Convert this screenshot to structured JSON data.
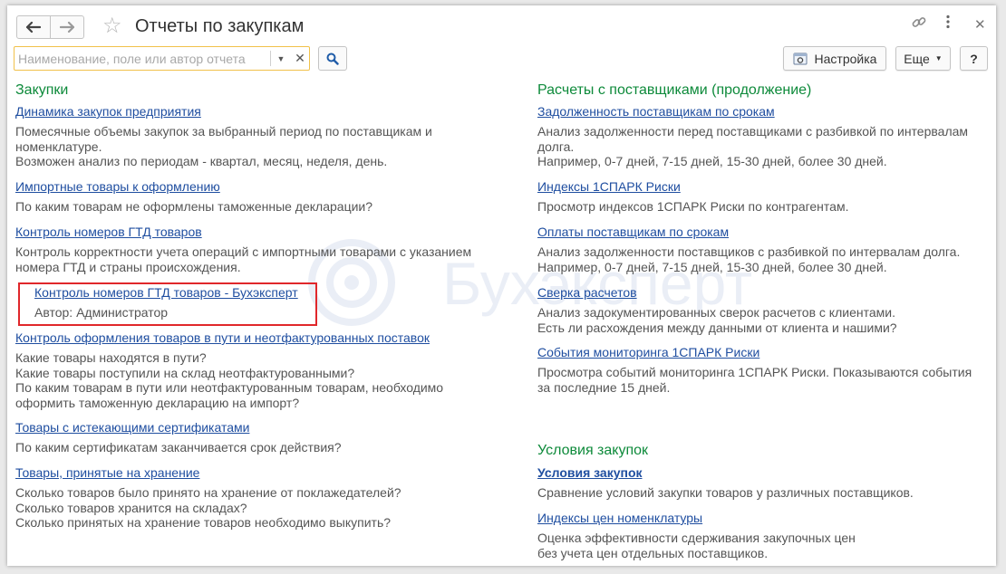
{
  "window": {
    "title": "Отчеты по закупкам",
    "watermark": "Бухэксперт"
  },
  "toolbar": {
    "search_placeholder": "Наименование, поле или автор отчета",
    "settings_label": "Настройка",
    "more_label": "Еще",
    "help_label": "?"
  },
  "icons": {
    "back": "arrow-left-icon",
    "forward": "arrow-right-icon",
    "favorite": "star-icon",
    "link": "link-icon",
    "menu": "kebab-menu-icon",
    "close": "close-icon",
    "search": "search-icon",
    "settings": "settings-icon"
  },
  "colors": {
    "section_title": "#0d8a3a",
    "link": "#1f4ea0",
    "highlight_border": "#e0272b",
    "search_border": "#f1c14a"
  },
  "left": {
    "section_title": "Закупки",
    "items": [
      {
        "link": "Динамика закупок предприятия",
        "desc": "Помесячные объемы закупок за выбранный период по поставщикам и\nноменклатуре.\nВозможен анализ по периодам - квартал, месяц, неделя, день."
      },
      {
        "link": "Импортные товары к оформлению",
        "desc": "По каким товарам не оформлены таможенные декларации?"
      },
      {
        "link": "Контроль номеров ГТД товаров",
        "desc": "Контроль корректности учета операций с импортными товарами с указанием\nномера ГТД и страны происхождения."
      },
      {
        "link": "Контроль номеров ГТД товаров - Бухэксперт",
        "desc": "Автор: Администратор"
      },
      {
        "link": "Контроль оформления товаров в пути и неотфактурованных поставок",
        "desc": "Какие товары находятся в пути?\nКакие товары поступили на склад неотфактурованными?\nПо каким товарам в пути или неотфактурованным товарам, необходимо\nоформить таможенную декларацию на импорт?"
      },
      {
        "link": "Товары с истекающими сертификатами",
        "desc": "По каким сертификатам заканчивается срок действия?"
      },
      {
        "link": "Товары, принятые на хранение",
        "desc": "Сколько товаров было принято на хранение от поклажедателей?\nСколько товаров хранится на складах?\nСколько принятых на хранение товаров необходимо выкупить?"
      }
    ]
  },
  "right": {
    "section_title": "Расчеты с поставщиками (продолжение)",
    "items": [
      {
        "link": "Задолженность поставщикам по срокам",
        "desc": "Анализ задолженности перед поставщиками с разбивкой по интервалам\nдолга.\nНапример, 0-7 дней, 7-15 дней, 15-30 дней, более 30 дней."
      },
      {
        "link": "Индексы 1СПАРК Риски",
        "desc": "Просмотр индексов 1СПАРК Риски по контрагентам."
      },
      {
        "link": "Оплаты поставщикам по срокам",
        "desc": "Анализ задолженности поставщиков с разбивкой по интервалам долга.\nНапример, 0-7 дней, 7-15 дней, 15-30 дней, более 30 дней."
      },
      {
        "link": "Сверка расчетов",
        "desc": "Анализ задокументированных сверок расчетов с клиентами.\nЕсть ли расхождения между данными от клиента и нашими?"
      },
      {
        "link": "События мониторинга 1СПАРК Риски",
        "desc": "Просмотра событий мониторинга 1СПАРК Риски. Показываются события\nза последние 15 дней."
      }
    ],
    "section2_title": "Условия закупок",
    "items2": [
      {
        "link": "Условия закупок",
        "desc": "Сравнение условий закупки товаров у различных поставщиков."
      },
      {
        "link": "Индексы цен номенклатуры",
        "desc": "Оценка эффективности сдерживания закупочных цен\nбез учета цен отдельных поставщиков."
      }
    ]
  }
}
